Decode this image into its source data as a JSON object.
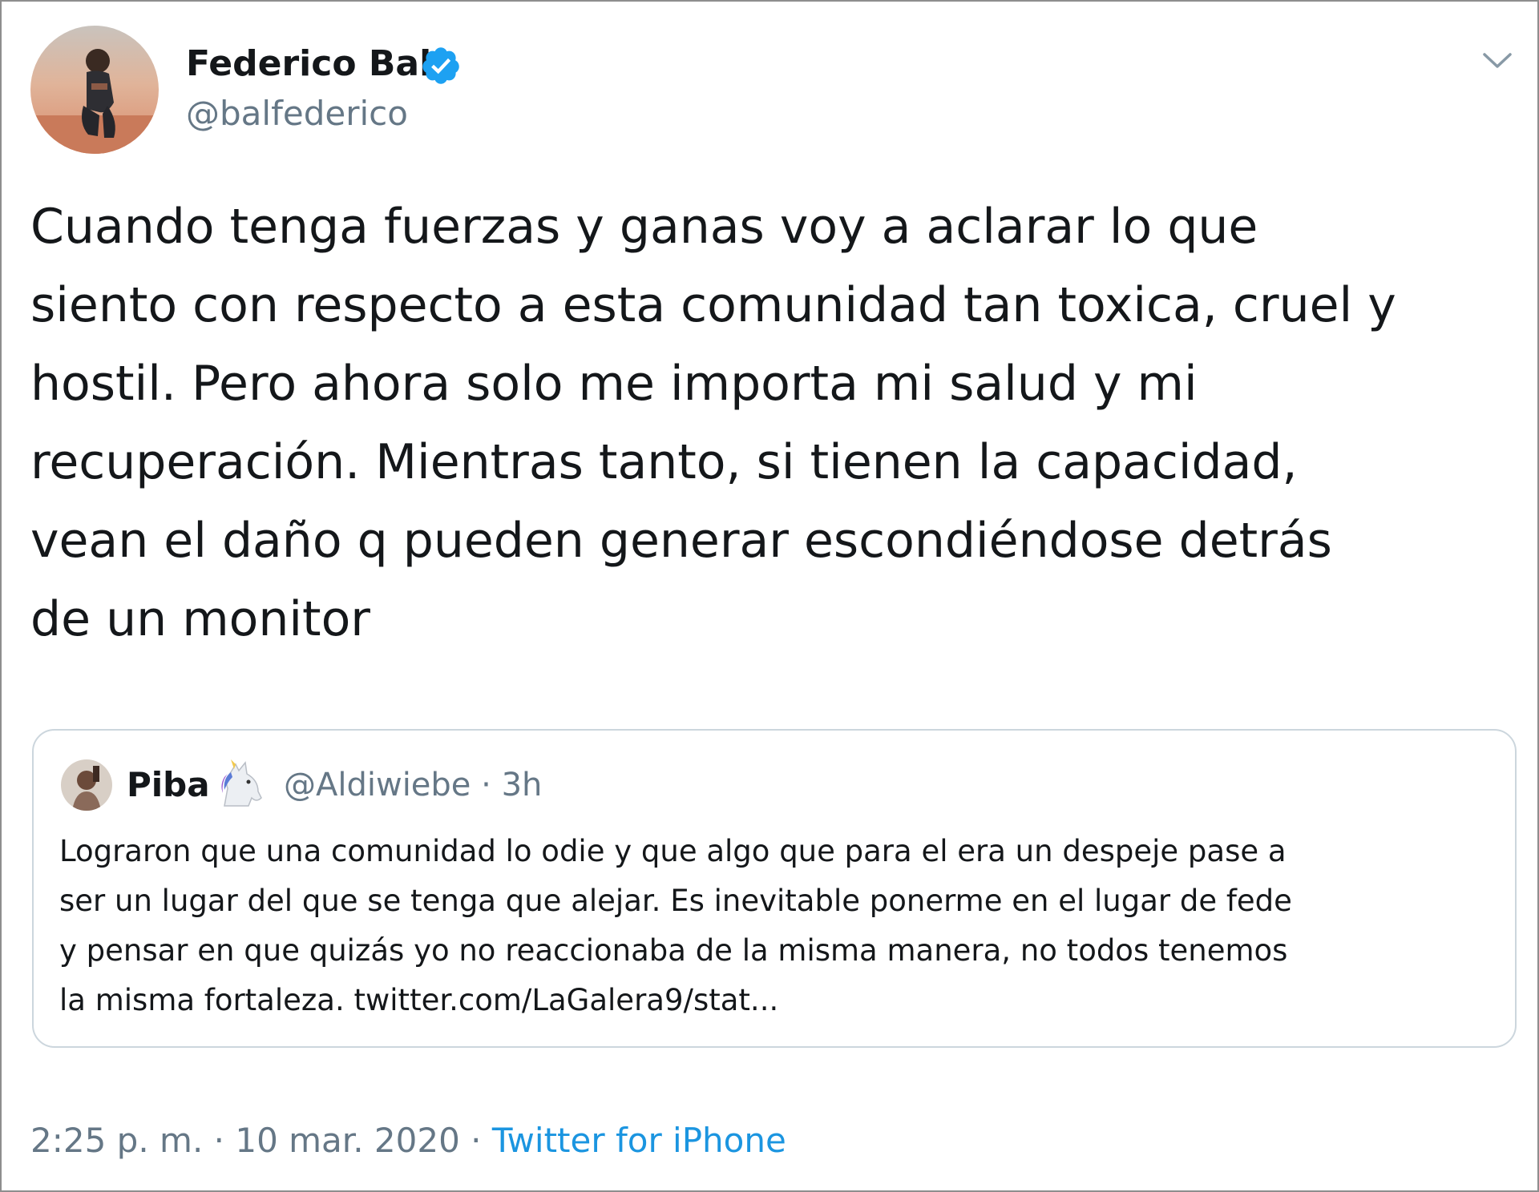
{
  "author": {
    "display_name": "Federico Bal",
    "handle": "@balfederico",
    "verified": true
  },
  "tweet": {
    "text": "Cuando tenga fuerzas y ganas voy a aclarar lo que\nsiento con respecto a esta comunidad tan toxica, cruel y\nhostil. Pero ahora solo me importa mi salud y mi\nrecuperación. Mientras tanto, si tienen la capacidad,\nvean el daño q pueden generar escondiéndose detrás\nde un monitor"
  },
  "quoted_tweet": {
    "display_name": "Piba",
    "name_emoji": "unicorn-icon",
    "meta": "@Aldiwiebe · 3h",
    "text": "Lograron que una comunidad lo odie y que algo que para el era un despeje pase a\nser un lugar del que se tenga que alejar. Es inevitable ponerme en el lugar de fede\ny pensar en que quizás yo no reaccionaba de la misma manera, no todos tenemos\nla misma fortaleza. twitter.com/LaGalera9/stat..."
  },
  "footer": {
    "timestamp": "2:25 p. m. · 10 mar. 2020 · ",
    "source": "Twitter for iPhone"
  },
  "colors": {
    "text": "#14171a",
    "secondary": "#657786",
    "link": "#1b95e0",
    "verified": "#1da1f2",
    "border": "#ccd6dd"
  },
  "icons": [
    "verified-badge-icon",
    "chevron-down-icon",
    "unicorn-icon"
  ]
}
